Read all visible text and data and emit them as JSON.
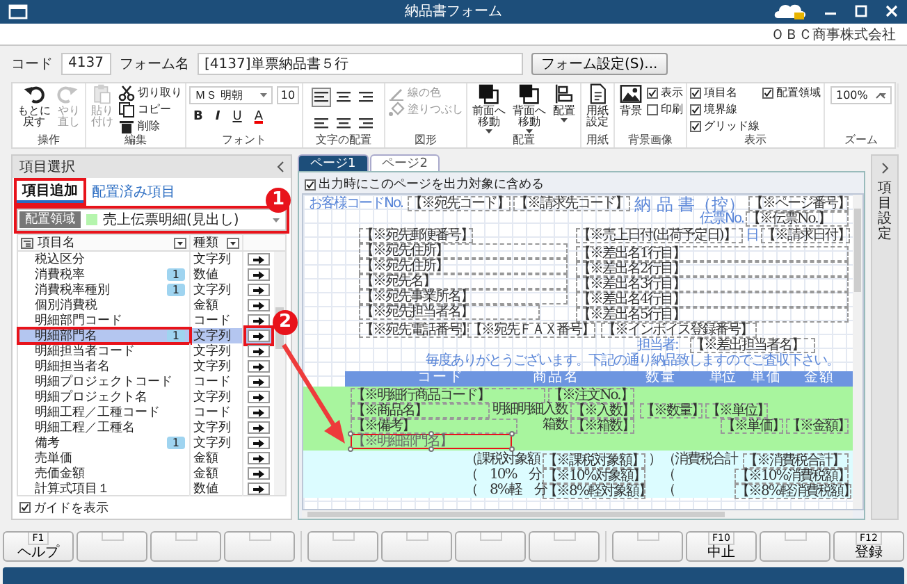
{
  "window": {
    "title": "納品書フォーム",
    "company": "ＯＢＣ商事株式会社"
  },
  "form_info": {
    "code_label": "コード",
    "code": "4137",
    "name_label": "フォーム名",
    "name": "[4137]単票納品書５行",
    "settings_button": "フォーム設定(S)..."
  },
  "ribbon": {
    "groups": [
      {
        "label": "操作",
        "kind": "tools",
        "items": [
          {
            "kind": "big",
            "label": "もとに戻す",
            "disabled": false
          },
          {
            "kind": "big",
            "label": "やり直し",
            "disabled": true
          }
        ]
      },
      {
        "label": "編集",
        "kind": "tools",
        "items": [
          {
            "kind": "big",
            "label": "貼り付け",
            "disabled": true
          },
          {
            "kind": "small",
            "label": "切り取り",
            "disabled": false
          },
          {
            "kind": "small",
            "label": "コピー",
            "disabled": false
          },
          {
            "kind": "small",
            "label": "削除",
            "disabled": false
          }
        ]
      },
      {
        "label": "フォント",
        "kind": "font",
        "items": [
          {
            "kind": "font",
            "value": "ＭＳ 明朝"
          },
          {
            "kind": "size",
            "value": "10"
          },
          {
            "kind": "format",
            "label": "B"
          },
          {
            "kind": "format",
            "label": "I"
          },
          {
            "kind": "format",
            "label": "U"
          },
          {
            "kind": "format",
            "label": "A"
          }
        ]
      },
      {
        "label": "文字の配置",
        "kind": "align",
        "items": [
          {
            "selected": true
          },
          {
            "selected": false
          },
          {
            "selected": false
          },
          {
            "selected": false
          },
          {
            "selected": false
          },
          {
            "selected": false
          }
        ]
      },
      {
        "label": "図形",
        "kind": "tools",
        "items": [
          {
            "kind": "small",
            "label": "線の色",
            "disabled": true
          },
          {
            "kind": "small",
            "label": "塗りつぶし",
            "disabled": true
          }
        ]
      },
      {
        "label": "配置",
        "kind": "tools",
        "items": [
          {
            "kind": "big",
            "label": "前面へ移動",
            "disabled": false,
            "dropdown": true
          },
          {
            "kind": "big",
            "label": "背面へ移動",
            "disabled": false,
            "dropdown": true
          },
          {
            "kind": "big",
            "label": "配置",
            "disabled": false,
            "dropdown": true
          }
        ]
      },
      {
        "label": "用紙",
        "kind": "tools",
        "items": [
          {
            "kind": "big",
            "label": "用紙設定",
            "disabled": false
          }
        ]
      },
      {
        "label": "背景画像",
        "kind": "tools",
        "items": [
          {
            "kind": "big",
            "label": "背景",
            "disabled": false
          },
          {
            "kind": "check",
            "label": "表示",
            "checked": true
          },
          {
            "kind": "check",
            "label": "印刷",
            "checked": false
          }
        ]
      },
      {
        "label": "表示",
        "kind": "tools",
        "items": [
          {
            "kind": "check",
            "label": "項目名",
            "checked": true
          },
          {
            "kind": "check",
            "label": "境界線",
            "checked": true
          },
          {
            "kind": "check",
            "label": "グリッド線",
            "checked": true
          },
          {
            "kind": "check",
            "label": "配置領域",
            "checked": true
          }
        ]
      },
      {
        "label": "ズーム",
        "kind": "zoom",
        "items": [
          {
            "kind": "zoom",
            "value": "100%"
          }
        ]
      }
    ]
  },
  "item_panel": {
    "title": "項目選択",
    "tabs": [
      {
        "label": "項目追加",
        "selected": true,
        "highlighted": true
      },
      {
        "label": "配置済み項目",
        "selected": false,
        "highlighted": false
      }
    ],
    "area": {
      "label": "配置領域",
      "value": "売上伝票明細(見出し)",
      "color": "#b5f5ad",
      "highlighted": true
    },
    "columns": [
      "項目名",
      "種類"
    ],
    "rows": [
      {
        "name": "税込区分",
        "type": "文字列",
        "selected": false,
        "highlighted": false
      },
      {
        "name": "消費税率",
        "count": "1",
        "type": "数値",
        "selected": false,
        "highlighted": false
      },
      {
        "name": "消費税率種別",
        "count": "1",
        "type": "文字列",
        "selected": false,
        "highlighted": false
      },
      {
        "name": "個別消費税",
        "type": "金額",
        "selected": false,
        "highlighted": false
      },
      {
        "name": "明細部門コード",
        "type": "コード",
        "selected": false,
        "highlighted": false
      },
      {
        "name": "明細部門名",
        "count": "1",
        "type": "文字列",
        "selected": true,
        "highlighted": true
      },
      {
        "name": "明細担当者コード",
        "type": "文字列",
        "selected": false,
        "highlighted": false
      },
      {
        "name": "明細担当者名",
        "type": "文字列",
        "selected": false,
        "highlighted": false
      },
      {
        "name": "明細プロジェクトコード",
        "type": "コード",
        "selected": false,
        "highlighted": false
      },
      {
        "name": "明細プロジェクト名",
        "type": "文字列",
        "selected": false,
        "highlighted": false
      },
      {
        "name": "明細工程／工種コード",
        "type": "コード",
        "selected": false,
        "highlighted": false
      },
      {
        "name": "明細工程／工種名",
        "type": "文字列",
        "selected": false,
        "highlighted": false
      },
      {
        "name": "備考",
        "count": "1",
        "type": "文字列",
        "selected": false,
        "highlighted": false
      },
      {
        "name": "売単価",
        "type": "金額",
        "selected": false,
        "highlighted": false
      },
      {
        "name": "売価金額",
        "type": "金額",
        "selected": false,
        "highlighted": false
      },
      {
        "name": "計算式項目１",
        "type": "数値",
        "selected": false,
        "highlighted": false
      }
    ],
    "guide": {
      "label": "ガイドを表示",
      "checked": true
    }
  },
  "designer": {
    "tabs": [
      {
        "label": "ページ1",
        "selected": true
      },
      {
        "label": "ページ2",
        "selected": false
      }
    ],
    "include_page": {
      "label": "出力時にこのページを出力対象に含める",
      "checked": true
    },
    "items": [
      {
        "text": "お客様コードNo.",
        "kind": "label"
      },
      {
        "text": "【※宛先コード】",
        "kind": "field"
      },
      {
        "text": "【※請求先コード】",
        "kind": "field"
      },
      {
        "text": "納 品 書（控）",
        "kind": "title"
      },
      {
        "text": "【※ページ番号】",
        "kind": "field"
      },
      {
        "text": "伝票No.",
        "kind": "label"
      },
      {
        "text": "【※伝票No.】",
        "kind": "field"
      },
      {
        "text": "【※宛先郵便番号】",
        "kind": "field"
      },
      {
        "text": "【※売上日付(出荷予定日)】",
        "kind": "field"
      },
      {
        "text": "日",
        "kind": "label"
      },
      {
        "text": "【※請求日付】",
        "kind": "field"
      },
      {
        "text": "【※宛先住所】",
        "kind": "field"
      },
      {
        "text": "【※宛先住所】",
        "kind": "field"
      },
      {
        "text": "【※宛先名】",
        "kind": "field"
      },
      {
        "text": "【※宛先事業所名】",
        "kind": "field"
      },
      {
        "text": "【※宛先担当者名】",
        "kind": "field"
      },
      {
        "text": "【※宛先電話番号】",
        "kind": "field"
      },
      {
        "text": "【※宛先ＦＡＸ番号】",
        "kind": "field"
      },
      {
        "text": "【※差出名1行目】",
        "kind": "field"
      },
      {
        "text": "【※差出名2行目】",
        "kind": "field"
      },
      {
        "text": "【※差出名3行目】",
        "kind": "field"
      },
      {
        "text": "【※差出名4行目】",
        "kind": "field"
      },
      {
        "text": "【※差出名5行目】",
        "kind": "field"
      },
      {
        "text": "【※インボイス登録番号】",
        "kind": "field"
      },
      {
        "text": "担当者:",
        "kind": "label"
      },
      {
        "text": "【※差出担当者名】",
        "kind": "field"
      },
      {
        "text": "毎度ありがとうございます。下記の通り納品致しますのでご査収下さい。",
        "kind": "label"
      },
      {
        "text": "コ ー ド",
        "kind": "header"
      },
      {
        "text": "商 品 名",
        "kind": "header"
      },
      {
        "text": "数 量",
        "kind": "header"
      },
      {
        "text": "単位",
        "kind": "header"
      },
      {
        "text": "単 価",
        "kind": "header"
      },
      {
        "text": "金 額",
        "kind": "header"
      },
      {
        "text": "【※明細行商品コード】",
        "kind": "field"
      },
      {
        "text": "【※注文No.】",
        "kind": "field"
      },
      {
        "text": "【※商品名】",
        "kind": "field"
      },
      {
        "text": "明細明細入数",
        "kind": "text"
      },
      {
        "text": "【※入数】",
        "kind": "field"
      },
      {
        "text": "【※数量】",
        "kind": "field"
      },
      {
        "text": "【※単位】",
        "kind": "field"
      },
      {
        "text": "【※備考】",
        "kind": "field"
      },
      {
        "text": "箱数",
        "kind": "text"
      },
      {
        "text": "【※箱数】",
        "kind": "field"
      },
      {
        "text": "【※単価】",
        "kind": "field"
      },
      {
        "text": "【※金額】",
        "kind": "field"
      },
      {
        "text": "【※明細部門名】",
        "kind": "selected_field"
      },
      {
        "text": "（課税対象額",
        "kind": "text"
      },
      {
        "text": "【※課税対象額】",
        "kind": "field"
      },
      {
        "text": "）",
        "kind": "text"
      },
      {
        "text": "（消費税合計",
        "kind": "text"
      },
      {
        "text": "【※消費税合計】",
        "kind": "field"
      },
      {
        "text": "（　10%　分",
        "kind": "text"
      },
      {
        "text": "【※10%対象額】",
        "kind": "field"
      },
      {
        "text": "（",
        "kind": "text"
      },
      {
        "text": "【※10%消費税額】",
        "kind": "field"
      },
      {
        "text": "（　8%軽　分",
        "kind": "text"
      },
      {
        "text": "【※8%軽対象額】",
        "kind": "field"
      },
      {
        "text": "（",
        "kind": "text"
      },
      {
        "text": "【※8%軽消費税額】",
        "kind": "field"
      }
    ],
    "side_panel": {
      "label": "項目設定"
    }
  },
  "annotations": [
    {
      "text": "1"
    },
    {
      "text": "2"
    }
  ],
  "function_keys": [
    {
      "kind": "labeled",
      "key": "F1",
      "label": "ヘルプ"
    },
    {
      "kind": "blank"
    },
    {
      "kind": "blank"
    },
    {
      "kind": "blank"
    },
    {
      "kind": "blank"
    },
    {
      "kind": "blank"
    },
    {
      "kind": "blank"
    },
    {
      "kind": "blank"
    },
    {
      "kind": "blank"
    },
    {
      "kind": "labeled",
      "key": "F10",
      "label": "中止"
    },
    {
      "kind": "blank"
    },
    {
      "kind": "labeled",
      "key": "F12",
      "label": "登録"
    }
  ]
}
